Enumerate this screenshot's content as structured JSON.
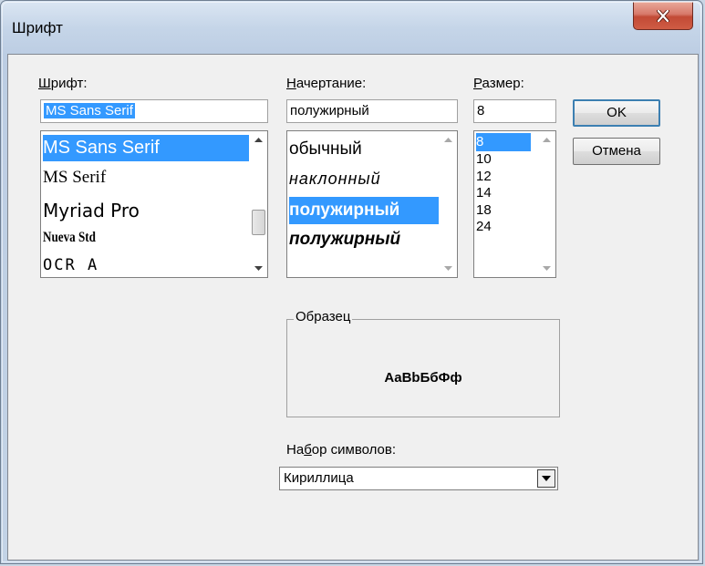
{
  "window": {
    "title": "Шрифт",
    "close_icon": "close-x-icon"
  },
  "font": {
    "label_accel": "Ш",
    "label_rest": "рифт:",
    "value": "MS Sans Serif",
    "items": [
      "MS Sans Serif",
      "MS Serif",
      "Myriad Pro",
      "Nueva Std",
      "OCR A"
    ],
    "selected_index": 0
  },
  "style": {
    "label_accel": "Н",
    "label_rest": "ачертание:",
    "value": "полужирный",
    "items": [
      "обычный",
      "наклонный",
      "полужирный",
      "полужирный"
    ],
    "selected_index": 2
  },
  "size": {
    "label_accel": "Р",
    "label_rest": "азмер:",
    "value": "8",
    "items": [
      "8",
      "10",
      "12",
      "14",
      "18",
      "24"
    ],
    "selected_index": 0
  },
  "buttons": {
    "ok": "OK",
    "cancel": "Отмена"
  },
  "sample": {
    "legend": "Образец",
    "text": "AaBbБбФф"
  },
  "charset": {
    "label_pre": "На",
    "label_accel": "б",
    "label_rest": "ор символов:",
    "value": "Кириллица"
  },
  "colors": {
    "selection": "#3399ff",
    "close_button": "#c24a36"
  }
}
